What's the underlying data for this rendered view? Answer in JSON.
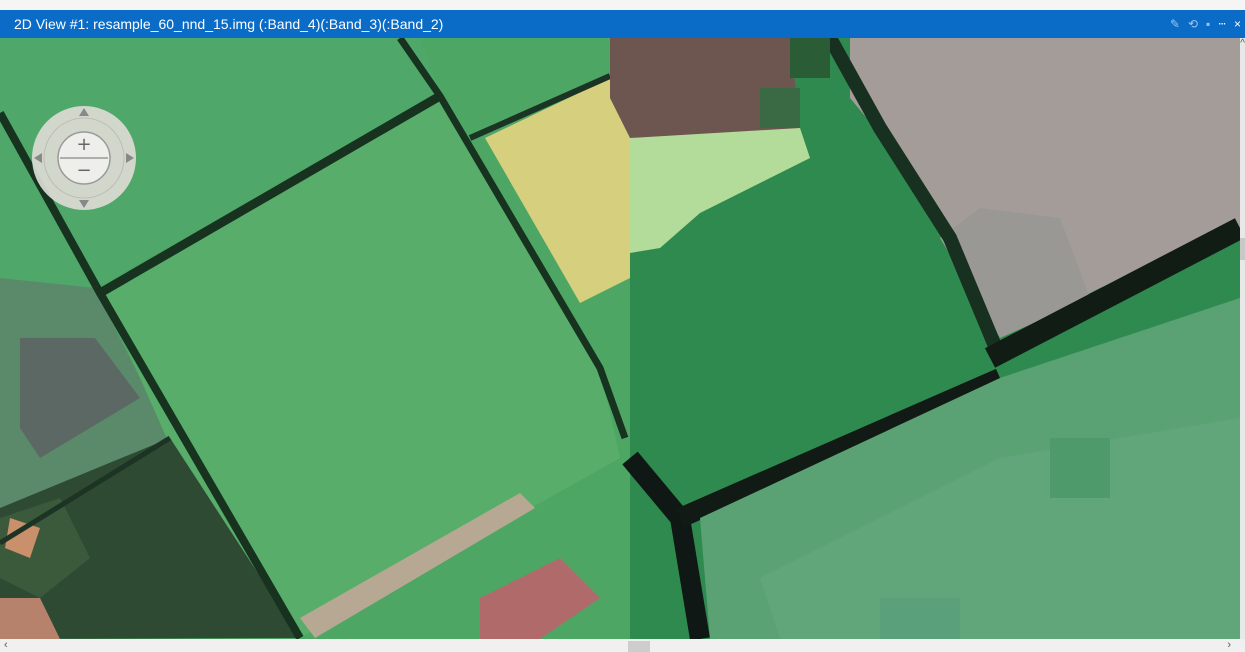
{
  "window": {
    "title": "2D View #1: resample_60_nnd_15.img (:Band_4)(:Band_3)(:Band_2)",
    "controls": [
      {
        "name": "pencil-icon",
        "glyph": "✎"
      },
      {
        "name": "refresh-icon",
        "glyph": "⟲"
      },
      {
        "name": "lock-icon",
        "glyph": "🔒"
      },
      {
        "name": "pin-icon",
        "glyph": "ᵖ"
      },
      {
        "name": "close-icon",
        "glyph": "×"
      }
    ]
  },
  "navigation": {
    "zoom_in_glyph": "+",
    "zoom_out_glyph": "−",
    "pan_icons": [
      "pan-up-icon",
      "pan-right-icon",
      "pan-down-icon",
      "pan-left-icon"
    ]
  },
  "scrollbars": {
    "left_arrow": "‹",
    "right_arrow": "›",
    "up_arrow": "^"
  },
  "colors": {
    "title_bar": "#0a6cc6",
    "field_light": "#5fb06a",
    "field_dark": "#2f7a45",
    "boundary": "#142a1c",
    "yellow_field": "#d7cf7a",
    "gray_area": "#a49c98"
  }
}
